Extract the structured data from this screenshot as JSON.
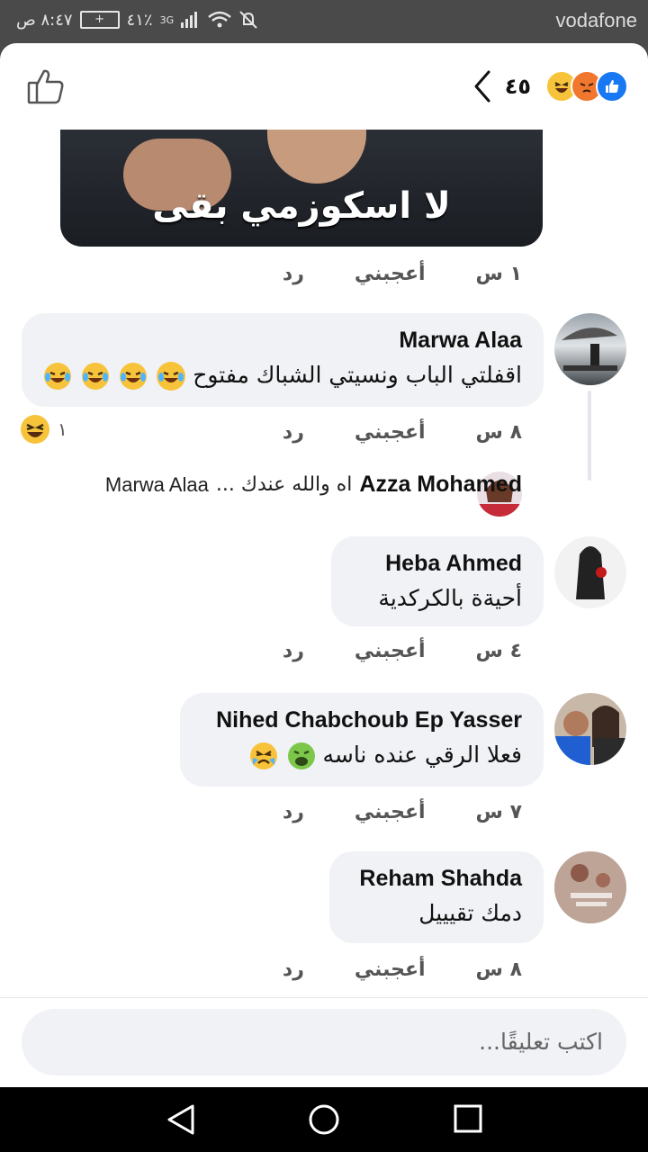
{
  "status": {
    "carrier": "vodafone",
    "time": "٨:٤٧ ص",
    "battery": "٤١٪",
    "network": "3G"
  },
  "header": {
    "reaction_count": "٤٥"
  },
  "post": {
    "image_caption": "لا اسكوزمي بقى",
    "time": "١ س",
    "like_label": "أعجبني",
    "reply_label": "رد"
  },
  "comments": [
    {
      "name": "Marwa Alaa",
      "text": "اقفلتي الباب ونسيتي الشباك مفتوح",
      "emojis": [
        "laughing-tears",
        "laughing-tears",
        "laughing-tears",
        "laughing-tears"
      ],
      "time": "٨ س",
      "like_label": "أعجبني",
      "reply_label": "رد",
      "reaction_count": "١",
      "reply_preview": {
        "name": "Azza Mohamed",
        "text": "اه والله عندك ...",
        "mention": "Marwa Alaa"
      }
    },
    {
      "name": "Heba Ahmed",
      "text": "أحيةة بالكركدية",
      "time": "٤ س",
      "like_label": "أعجبني",
      "reply_label": "رد"
    },
    {
      "name": "Nihed Chabchoub Ep Yasser",
      "text": "فعلا الرقي عنده ناسه",
      "emojis": [
        "vomiting-face",
        "crying-face"
      ],
      "time": "٧ س",
      "like_label": "أعجبني",
      "reply_label": "رد"
    },
    {
      "name": "Reham Shahda",
      "text": "دمك تقيييل",
      "time": "٨ س",
      "like_label": "أعجبني",
      "reply_label": "رد"
    }
  ],
  "composer": {
    "placeholder": "اكتب تعليقًا..."
  },
  "colors": {
    "accent": "#1877f2",
    "bubble": "#f0f2f5"
  }
}
